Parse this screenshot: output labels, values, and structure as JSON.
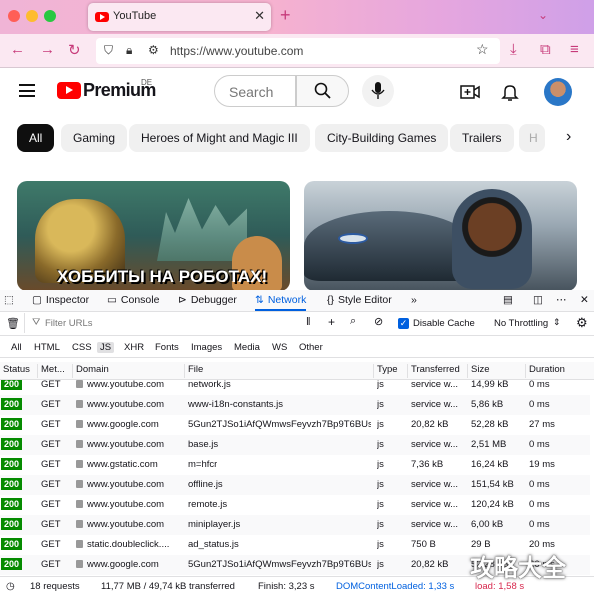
{
  "browser": {
    "tab_title": "YouTube",
    "url": "https://www.youtube.com"
  },
  "youtube": {
    "brand": "Premium",
    "region": "DE",
    "search_placeholder": "Search",
    "chips": [
      "All",
      "Gaming",
      "Heroes of Might and Magic III",
      "City-Building Games",
      "Trailers",
      "H"
    ],
    "thumb1_text": "ХОББИТЫ НА РОБОТАХ!"
  },
  "devtools": {
    "tabs": [
      "Inspector",
      "Console",
      "Debugger",
      "Network",
      "Style Editor"
    ],
    "filter_placeholder": "Filter URLs",
    "disable_cache": "Disable Cache",
    "throttling": "No Throttling",
    "type_filters": [
      "All",
      "HTML",
      "CSS",
      "JS",
      "XHR",
      "Fonts",
      "Images",
      "Media",
      "WS",
      "Other"
    ],
    "columns": [
      "Status",
      "Met...",
      "Domain",
      "File",
      "Type",
      "Transferred",
      "Size",
      "Duration"
    ],
    "rows": [
      {
        "status": "200",
        "method": "GET",
        "domain": "www.youtube.com",
        "file": "network.js",
        "type": "js",
        "transferred": "service w...",
        "size": "14,99 kB",
        "duration": "0 ms"
      },
      {
        "status": "200",
        "method": "GET",
        "domain": "www.youtube.com",
        "file": "www-i18n-constants.js",
        "type": "js",
        "transferred": "service w...",
        "size": "5,86 kB",
        "duration": "0 ms"
      },
      {
        "status": "200",
        "method": "GET",
        "domain": "www.google.com",
        "file": "5Gun2TJSo1iAfQWmwsFeyvzh7Bp9T6BUs",
        "type": "js",
        "transferred": "20,82 kB",
        "size": "52,28 kB",
        "duration": "27 ms"
      },
      {
        "status": "200",
        "method": "GET",
        "domain": "www.youtube.com",
        "file": "base.js",
        "type": "js",
        "transferred": "service w...",
        "size": "2,51 MB",
        "duration": "0 ms"
      },
      {
        "status": "200",
        "method": "GET",
        "domain": "www.gstatic.com",
        "file": "m=hfcr",
        "type": "js",
        "transferred": "7,36 kB",
        "size": "16,24 kB",
        "duration": "19 ms"
      },
      {
        "status": "200",
        "method": "GET",
        "domain": "www.youtube.com",
        "file": "offline.js",
        "type": "js",
        "transferred": "service w...",
        "size": "151,54 kB",
        "duration": "0 ms"
      },
      {
        "status": "200",
        "method": "GET",
        "domain": "www.youtube.com",
        "file": "remote.js",
        "type": "js",
        "transferred": "service w...",
        "size": "120,24 kB",
        "duration": "0 ms"
      },
      {
        "status": "200",
        "method": "GET",
        "domain": "www.youtube.com",
        "file": "miniplayer.js",
        "type": "js",
        "transferred": "service w...",
        "size": "6,00 kB",
        "duration": "0 ms"
      },
      {
        "status": "200",
        "method": "GET",
        "domain": "static.doubleclick....",
        "file": "ad_status.js",
        "type": "js",
        "transferred": "750 B",
        "size": "29 B",
        "duration": "20 ms"
      },
      {
        "status": "200",
        "method": "GET",
        "domain": "www.google.com",
        "file": "5Gun2TJSo1iAfQWmwsFeyvzh7Bp9T6BUs",
        "type": "js",
        "transferred": "20,82 kB",
        "size": "52,28 kB",
        "duration": "26 ms"
      }
    ],
    "footer": {
      "requests": "18 requests",
      "transferred": "11,77 MB / 49,74 kB transferred",
      "finish": "Finish: 3,23 s",
      "dcl": "DOMContentLoaded: 1,33 s",
      "load": "load: 1,58 s"
    }
  },
  "watermark": "攻略大全"
}
